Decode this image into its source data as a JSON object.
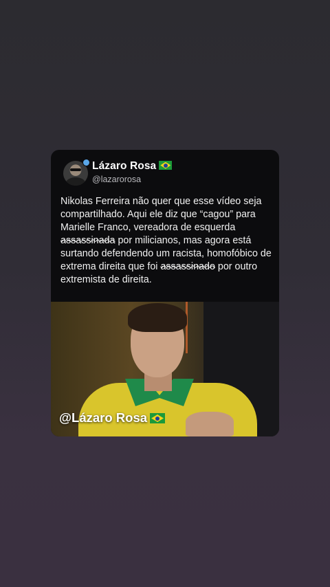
{
  "post": {
    "author_name": "Lázaro Rosa",
    "author_handle": "@lazarorosa",
    "text_part1": "Nikolas Ferreira não quer que esse vídeo seja compartilhado. Aqui ele diz que “cagou” para Marielle Franco, vereadora de esquerda ",
    "text_censored1": "assassinada",
    "text_part2": " por milicianos, mas agora está surtando defendendo um racista, homofóbico de extrema direita que foi ",
    "text_censored2": "assassinado",
    "text_part3": " por outro extremista de direita."
  },
  "video": {
    "watermark": "@Lázaro Rosa"
  },
  "icons": {
    "flag": "brazil-flag-icon",
    "verified": "verified-badge-icon"
  },
  "colors": {
    "background_top": "#2c2b30",
    "background_bottom": "#3a3040",
    "card": "#0c0c0e",
    "verified": "#5aa7e8"
  }
}
